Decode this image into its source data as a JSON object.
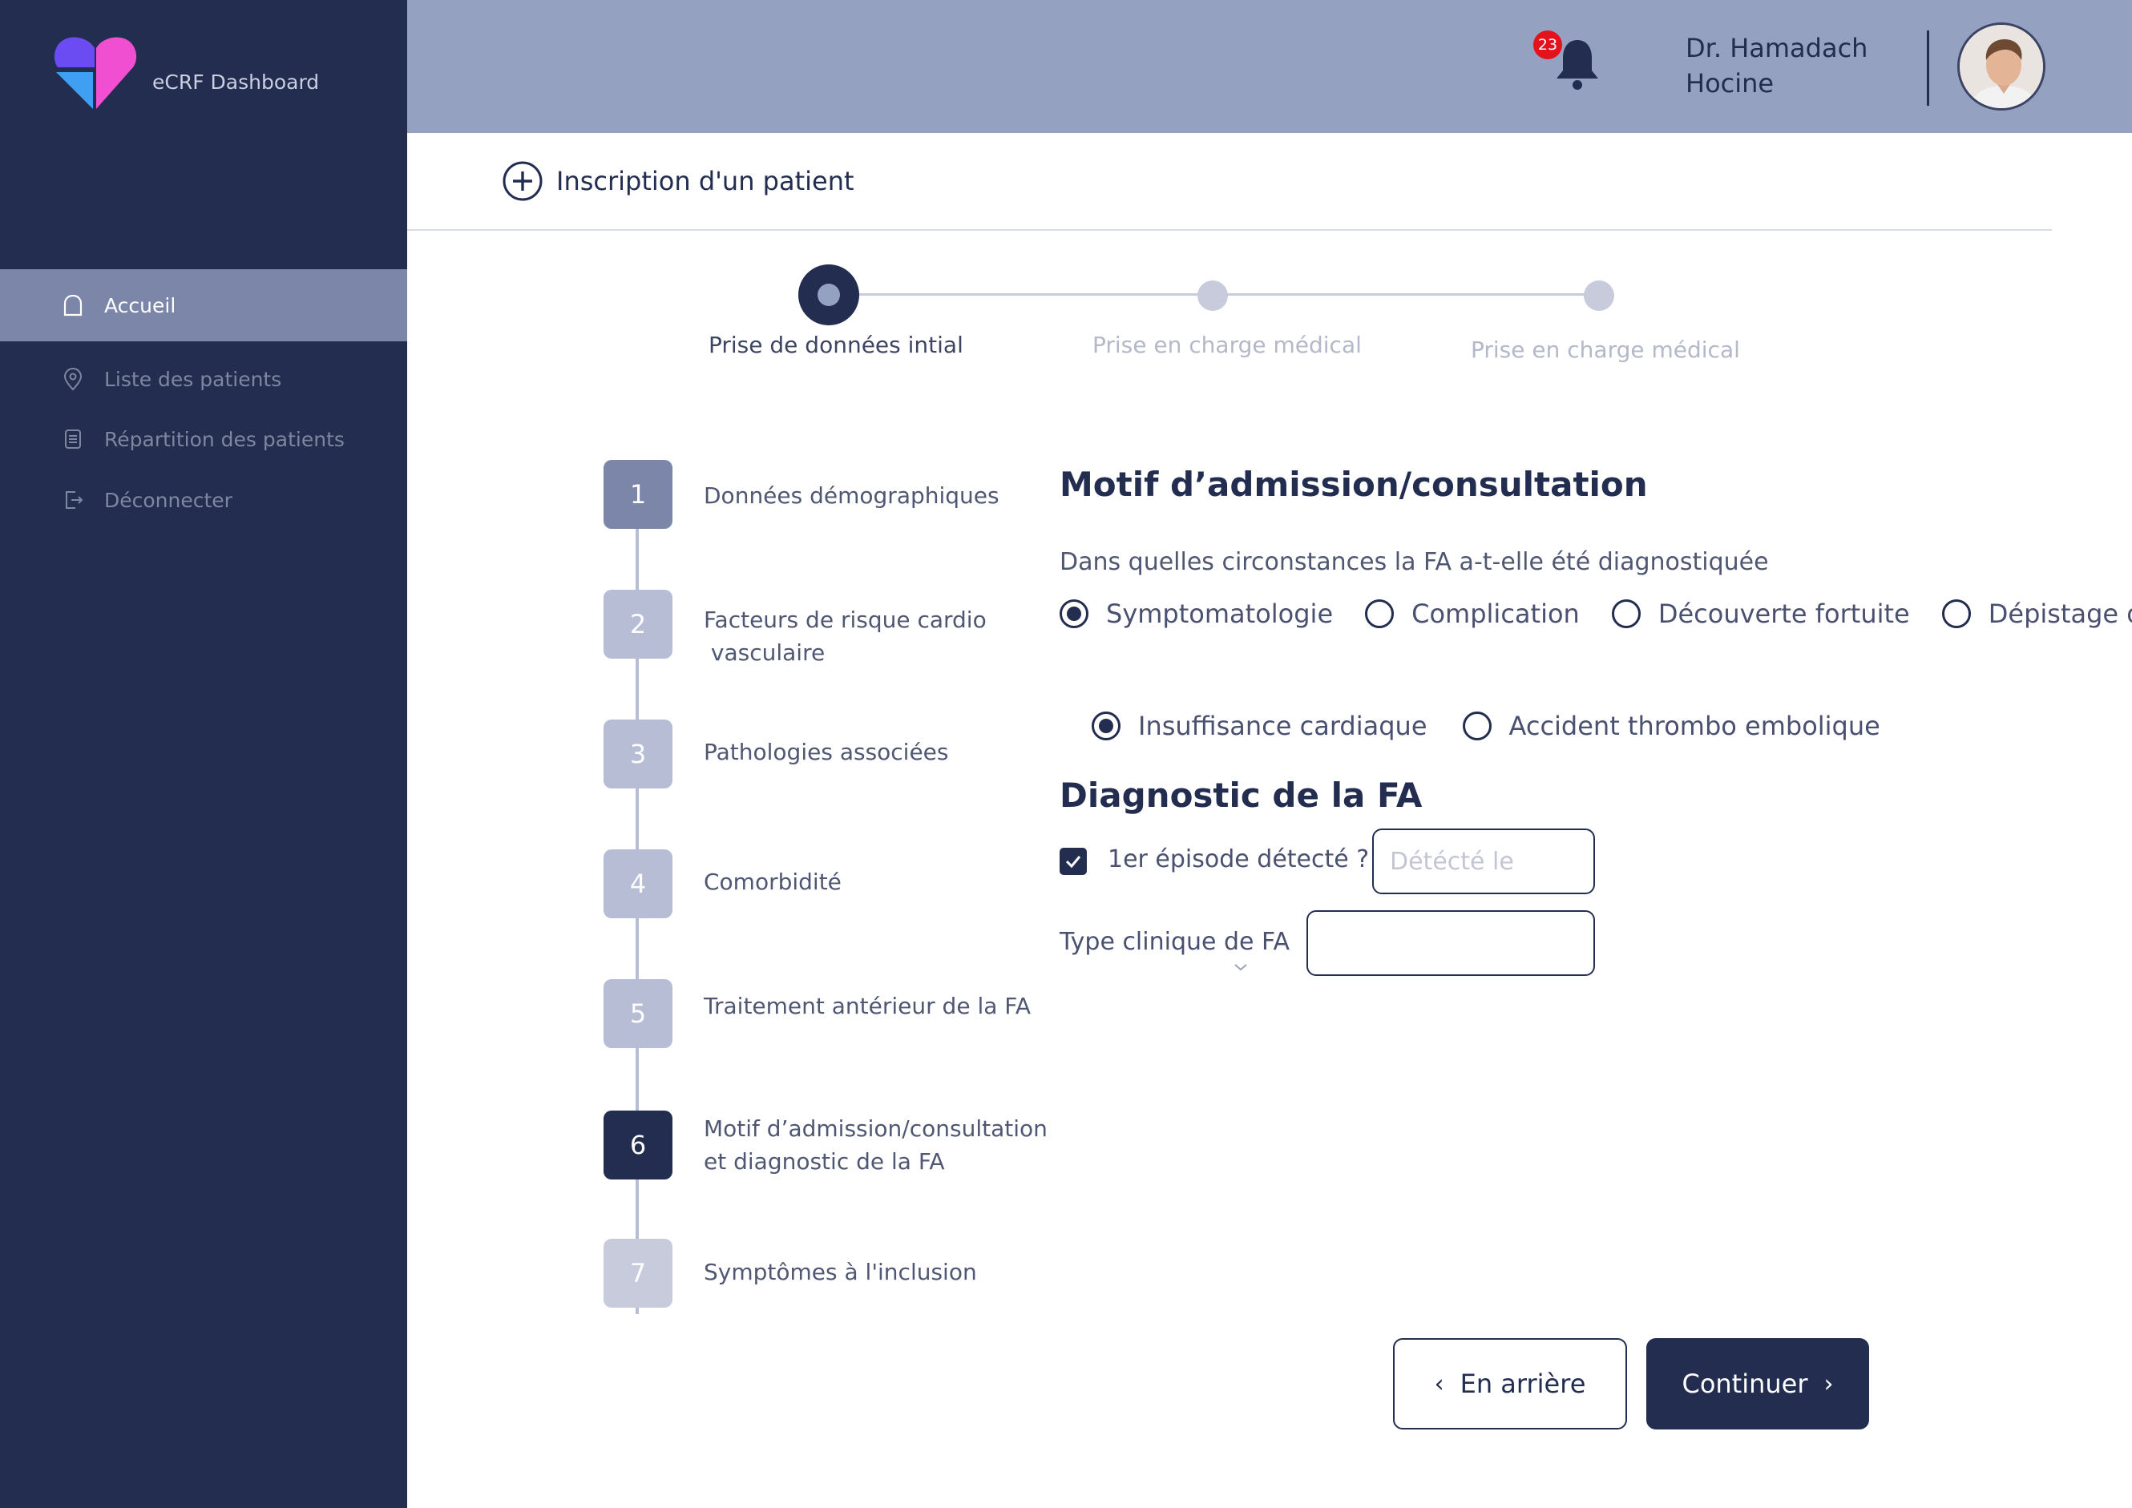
{
  "app": {
    "brand": "eCRF Dashboard"
  },
  "sidebar": {
    "items": [
      {
        "label": "Accueil",
        "icon": "home-icon",
        "active": true
      },
      {
        "label": "Liste des patients",
        "icon": "location-pin-icon",
        "active": false
      },
      {
        "label": "Répartition  des patients",
        "icon": "document-icon",
        "active": false
      },
      {
        "label": "Déconnecter",
        "icon": "logout-icon",
        "active": false
      }
    ]
  },
  "header": {
    "notifications_count": "23",
    "user_name": "Dr. Hamadach Hocine"
  },
  "page": {
    "title": "Inscription d'un patient"
  },
  "stepper": {
    "steps": [
      {
        "label": "Prise de données intial",
        "active": true
      },
      {
        "label": "Prise en charge médical",
        "active": false
      },
      {
        "label": "Prise en charge médical",
        "active": false
      }
    ]
  },
  "sections": [
    {
      "number": "1",
      "label_lines": [
        "Données démographiques"
      ],
      "state": "done"
    },
    {
      "number": "2",
      "label_lines": [
        "Facteurs de risque cardio",
        " vasculaire"
      ],
      "state": "pending"
    },
    {
      "number": "3",
      "label_lines": [
        "Pathologies associées"
      ],
      "state": "pending"
    },
    {
      "number": "4",
      "label_lines": [
        "Comorbidité"
      ],
      "state": "pending"
    },
    {
      "number": "5",
      "label_lines": [
        "Traitement antérieur de la FA"
      ],
      "state": "pending"
    },
    {
      "number": "6",
      "label_lines": [
        "Motif d’admission/consultation",
        "et diagnostic de la FA"
      ],
      "state": "current"
    },
    {
      "number": "7",
      "label_lines": [
        "Symptômes à l'inclusion"
      ],
      "state": "pending"
    }
  ],
  "form": {
    "motif_title": "Motif d’admission/consultation",
    "question": "Dans quelles circonstances la FA a-t-elle été diagnostiquée",
    "circumstances": [
      {
        "label": "Symptomatologie",
        "selected": true
      },
      {
        "label": "Complication",
        "selected": false
      },
      {
        "label": "Découverte fortuite",
        "selected": false
      },
      {
        "label": "Dépistage de FA",
        "selected": false
      }
    ],
    "complications": [
      {
        "label": "Insuffisance cardiaque",
        "selected": true
      },
      {
        "label": "Accident thrombo embolique",
        "selected": false
      }
    ],
    "diagnostic_title": "Diagnostic de la FA",
    "first_episode_label": "1er épisode détecté ?",
    "first_episode_checked": true,
    "detected_placeholder": "Détécté le",
    "type_label": "Type clinique de FA",
    "type_value": ""
  },
  "buttons": {
    "back": "En arrière",
    "next": "Continuer"
  },
  "colors": {
    "sidebar_bg": "#222d50",
    "active_nav_bg": "#7b86a9",
    "topbar_bg": "#94a1c0",
    "primary": "#222d50",
    "badge": "#e3121b"
  }
}
